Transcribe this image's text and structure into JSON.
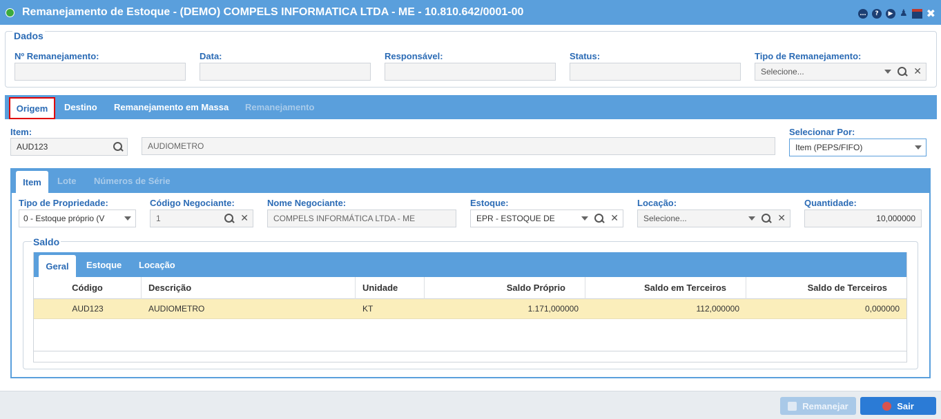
{
  "window": {
    "title": "Remanejamento de Estoque - (DEMO) COMPELS INFORMATICA LTDA - ME - 10.810.642/0001-00",
    "icons": [
      "chat-icon",
      "help-icon",
      "play-icon",
      "user-icon",
      "calendar-icon",
      "close-icon"
    ],
    "icon_glyphs": {
      "chat": "…",
      "help": "?",
      "play": "▶",
      "user": "♟",
      "close": "✖"
    }
  },
  "dados": {
    "legend": "Dados",
    "fields": {
      "numero": {
        "label": "Nº Remanejamento:",
        "value": ""
      },
      "data": {
        "label": "Data:",
        "value": ""
      },
      "responsavel": {
        "label": "Responsável:",
        "value": ""
      },
      "status": {
        "label": "Status:",
        "value": ""
      },
      "tipo": {
        "label": "Tipo de Remanejamento:",
        "placeholder": "Selecione...",
        "clear": "✕"
      }
    }
  },
  "main_tabs": [
    {
      "label": "Origem",
      "state": "active"
    },
    {
      "label": "Destino",
      "state": "normal"
    },
    {
      "label": "Remanejamento em Massa",
      "state": "normal"
    },
    {
      "label": "Remanejamento",
      "state": "disabled"
    }
  ],
  "item": {
    "label": "Item:",
    "code": "AUD123",
    "description": "AUDIOMETRO",
    "selecionar_label": "Selecionar Por:",
    "selecionar_value": "Item (PEPS/FIFO)"
  },
  "sub_tabs": [
    {
      "label": "Item",
      "state": "active"
    },
    {
      "label": "Lote",
      "state": "disabled"
    },
    {
      "label": "Números de Série",
      "state": "disabled"
    }
  ],
  "origem_fields": {
    "tipo_propriedade": {
      "label": "Tipo de Propriedade:",
      "value": "0 - Estoque próprio (V"
    },
    "codigo_negociante": {
      "label": "Código Negociante:",
      "value": "1",
      "clear": "✕"
    },
    "nome_negociante": {
      "label": "Nome Negociante:",
      "value": "COMPELS INFORMÁTICA LTDA - ME"
    },
    "estoque": {
      "label": "Estoque:",
      "value": "EPR - ESTOQUE DE",
      "clear": "✕"
    },
    "locacao": {
      "label": "Locação:",
      "placeholder": "Selecione...",
      "clear": "✕"
    },
    "quantidade": {
      "label": "Quantidade:",
      "value": "10,000000"
    }
  },
  "saldo": {
    "legend": "Saldo",
    "tabs": [
      {
        "label": "Geral",
        "state": "active"
      },
      {
        "label": "Estoque",
        "state": "normal"
      },
      {
        "label": "Locação",
        "state": "normal"
      }
    ],
    "columns": [
      "Código",
      "Descrição",
      "Unidade",
      "Saldo Próprio",
      "Saldo em Terceiros",
      "Saldo de Terceiros"
    ],
    "rows": [
      {
        "codigo": "AUD123",
        "descricao": "AUDIOMETRO",
        "unidade": "KT",
        "saldo_proprio": "1.171,000000",
        "saldo_em_terceiros": "112,000000",
        "saldo_de_terceiros": "0,000000"
      }
    ]
  },
  "buttons": {
    "remanejar": "Remanejar",
    "sair": "Sair"
  },
  "colors": {
    "accent": "#5a9fdc",
    "label": "#2b6bb5",
    "highlight_row": "#fbeebb",
    "tab_outline": "#e00000"
  }
}
